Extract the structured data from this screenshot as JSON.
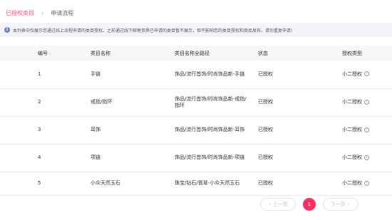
{
  "breadcrumb": {
    "parent": "已授权类目",
    "separator": "›",
    "current": "申请流程"
  },
  "notice": {
    "icon": "info-icon",
    "text": "本列表中仅展示您通过线上流程申请的类目授权。之前通过线下邮寄资质已申请的类目暂不展示，但不影响您的类目授权和商品发布，请勿重复申请!"
  },
  "table": {
    "headers": {
      "number": "编号",
      "name": "类目名称",
      "path": "类目名称全路径",
      "status": "状态",
      "type": "授权类型"
    },
    "rows": [
      {
        "number": "1",
        "name": "手链",
        "path": "饰品/流行首饰/时尚饰品新-手链",
        "status": "已授权",
        "type": "小二授权"
      },
      {
        "number": "2",
        "name": "戒指/指环",
        "path": "饰品/流行首饰/时尚饰品新-戒指/指环",
        "status": "已授权",
        "type": "小二授权"
      },
      {
        "number": "3",
        "name": "耳饰",
        "path": "饰品/流行首饰/时尚饰品新-耳饰",
        "status": "已授权",
        "type": "小二授权"
      },
      {
        "number": "4",
        "name": "项链",
        "path": "饰品/流行首饰/时尚饰品新-项链",
        "status": "已授权",
        "type": "小二授权"
      },
      {
        "number": "5",
        "name": "小众天然玉石",
        "path": "珠宝/钻石/翡翠-小众天然玉石",
        "status": "已授权",
        "type": "小二授权"
      }
    ]
  },
  "pagination": {
    "prev_label": "上一页",
    "next_label": "下一页",
    "current_page": "1",
    "accent": "#ff2f62"
  }
}
